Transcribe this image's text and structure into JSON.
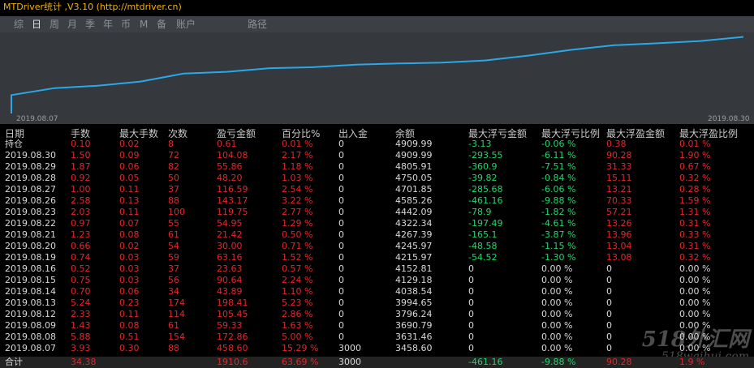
{
  "window": {
    "title": "MTDriver统计 ,V3.10 (http://mtdriver.cn)"
  },
  "tabs": [
    {
      "label": "综",
      "active": false
    },
    {
      "label": "日",
      "active": true
    },
    {
      "label": "周",
      "active": false
    },
    {
      "label": "月",
      "active": false
    },
    {
      "label": "季",
      "active": false
    },
    {
      "label": "年",
      "active": false
    },
    {
      "label": "币",
      "active": false
    },
    {
      "label": "M",
      "active": false
    },
    {
      "label": "备",
      "active": false
    },
    {
      "label": "账户",
      "active": false
    },
    {
      "label": "路径",
      "active": false
    }
  ],
  "chart_data": {
    "type": "line",
    "x": [
      "2019.08.07",
      "2019.08.08",
      "2019.08.09",
      "2019.08.12",
      "2019.08.13",
      "2019.08.14",
      "2019.08.15",
      "2019.08.16",
      "2019.08.19",
      "2019.08.20",
      "2019.08.21",
      "2019.08.22",
      "2019.08.23",
      "2019.08.26",
      "2019.08.27",
      "2019.08.28",
      "2019.08.29",
      "2019.08.30"
    ],
    "values": [
      3458.6,
      3631.46,
      3690.79,
      3796.24,
      3994.65,
      4038.54,
      4129.18,
      4152.81,
      4215.97,
      4245.97,
      4267.39,
      4322.34,
      4442.09,
      4585.26,
      4701.85,
      4750.05,
      4805.91,
      4909.99
    ],
    "xlabels": [
      "2019.08.07",
      "2019.08.30"
    ],
    "line_color": "#2aa8e8",
    "ylim": [
      3000,
      4960
    ]
  },
  "table": {
    "columns": [
      "日期",
      "手数",
      "最大手数",
      "次数",
      "盈亏金额",
      "百分比%",
      "出入金",
      "余额",
      "最大浮亏金额",
      "最大浮亏比例",
      "最大浮盈金额",
      "最大浮盈比例"
    ],
    "rows": [
      [
        "持仓",
        "0.10",
        "0.02",
        "8",
        "0.61",
        "0.01 %",
        "0",
        "4909.99",
        "-3.13",
        "-0.06 %",
        "0.38",
        "0.01 %"
      ],
      [
        "2019.08.30",
        "1.50",
        "0.09",
        "72",
        "104.08",
        "2.17 %",
        "0",
        "4909.99",
        "-293.55",
        "-6.11 %",
        "90.28",
        "1.90 %"
      ],
      [
        "2019.08.29",
        "1.87",
        "0.06",
        "82",
        "55.86",
        "1.18 %",
        "0",
        "4805.91",
        "-360.9",
        "-7.51 %",
        "31.33",
        "0.67 %"
      ],
      [
        "2019.08.28",
        "0.92",
        "0.05",
        "50",
        "48.20",
        "1.03 %",
        "0",
        "4750.05",
        "-39.82",
        "-0.84 %",
        "15.11",
        "0.32 %"
      ],
      [
        "2019.08.27",
        "1.00",
        "0.11",
        "37",
        "116.59",
        "2.54 %",
        "0",
        "4701.85",
        "-285.68",
        "-6.06 %",
        "13.21",
        "0.28 %"
      ],
      [
        "2019.08.26",
        "2.58",
        "0.13",
        "88",
        "143.17",
        "3.22 %",
        "0",
        "4585.26",
        "-461.16",
        "-9.88 %",
        "70.33",
        "1.59 %"
      ],
      [
        "2019.08.23",
        "2.03",
        "0.11",
        "100",
        "119.75",
        "2.77 %",
        "0",
        "4442.09",
        "-78.9",
        "-1.82 %",
        "57.21",
        "1.31 %"
      ],
      [
        "2019.08.22",
        "0.97",
        "0.07",
        "55",
        "54.95",
        "1.29 %",
        "0",
        "4322.34",
        "-197.49",
        "-4.61 %",
        "13.26",
        "0.31 %"
      ],
      [
        "2019.08.21",
        "1.23",
        "0.08",
        "61",
        "21.42",
        "0.50 %",
        "0",
        "4267.39",
        "-165.1",
        "-3.87 %",
        "13.96",
        "0.33 %"
      ],
      [
        "2019.08.20",
        "0.66",
        "0.02",
        "54",
        "30.00",
        "0.71 %",
        "0",
        "4245.97",
        "-48.58",
        "-1.15 %",
        "13.04",
        "0.31 %"
      ],
      [
        "2019.08.19",
        "0.74",
        "0.03",
        "59",
        "63.16",
        "1.52 %",
        "0",
        "4215.97",
        "-54.52",
        "-1.30 %",
        "13.08",
        "0.32 %"
      ],
      [
        "2019.08.16",
        "0.52",
        "0.03",
        "37",
        "23.63",
        "0.57 %",
        "0",
        "4152.81",
        "0",
        "0.00 %",
        "0",
        "0.00 %"
      ],
      [
        "2019.08.15",
        "0.75",
        "0.03",
        "56",
        "90.64",
        "2.24 %",
        "0",
        "4129.18",
        "0",
        "0.00 %",
        "0",
        "0.00 %"
      ],
      [
        "2019.08.14",
        "0.70",
        "0.06",
        "34",
        "43.89",
        "1.10 %",
        "0",
        "4038.54",
        "0",
        "0.00 %",
        "0",
        "0.00 %"
      ],
      [
        "2019.08.13",
        "5.24",
        "0.23",
        "174",
        "198.41",
        "5.23 %",
        "0",
        "3994.65",
        "0",
        "0.00 %",
        "0",
        "0.00 %"
      ],
      [
        "2019.08.12",
        "2.33",
        "0.11",
        "114",
        "105.45",
        "2.86 %",
        "0",
        "3796.24",
        "0",
        "0.00 %",
        "0",
        "0.00 %"
      ],
      [
        "2019.08.09",
        "1.43",
        "0.08",
        "61",
        "59.33",
        "1.63 %",
        "0",
        "3690.79",
        "0",
        "0.00 %",
        "0",
        "0.00 %"
      ],
      [
        "2019.08.08",
        "5.88",
        "0.51",
        "154",
        "172.86",
        "5.00 %",
        "0",
        "3631.46",
        "0",
        "0.00 %",
        "0",
        "0.00 %"
      ],
      [
        "2019.08.07",
        "3.93",
        "0.30",
        "88",
        "458.60",
        "15.29 %",
        "3000",
        "3458.60",
        "0",
        "0.00 %",
        "0",
        "0.00 %"
      ]
    ],
    "total": [
      "合计",
      "34.38",
      "",
      "",
      "1910.6",
      "63.69 %",
      "3000",
      "",
      "-461.16",
      "-9.88 %",
      "90.28",
      "1.9 %"
    ]
  },
  "watermark": {
    "line1": "518外汇网",
    "line2": "518waihui.com"
  },
  "colors": {
    "title": "#f5b400",
    "profit": "#e02828",
    "loss": "#22d66a",
    "neutral": "#d8d8d8",
    "chart_line": "#2aa8e8"
  }
}
